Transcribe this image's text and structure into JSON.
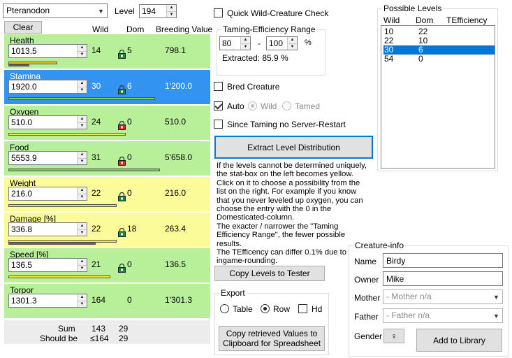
{
  "species": {
    "selected": "Pteranodon"
  },
  "level": {
    "label": "Level",
    "value": "194"
  },
  "clear_label": "Clear",
  "headers": {
    "wild": "Wild",
    "dom": "Dom",
    "breeding": "Breeding Value"
  },
  "stats": [
    {
      "name": "Health",
      "value": "1013.5",
      "wild": "14",
      "dom": "5",
      "breeding": "798.1",
      "bg": "#b8f09a",
      "lock": "unlocked"
    },
    {
      "name": "Stamina",
      "value": "1920.0",
      "wild": "30",
      "dom": "6",
      "breeding": "1'200.0",
      "bg": "#3294f0",
      "lock": "unlocked"
    },
    {
      "name": "Oxygen",
      "value": "510.0",
      "wild": "24",
      "dom": "0",
      "breeding": "510.0",
      "bg": "#b8f09a",
      "lock": "locked"
    },
    {
      "name": "Food",
      "value": "5553.9",
      "wild": "31",
      "dom": "0",
      "breeding": "5'658.0",
      "bg": "#b8f09a",
      "lock": "locked"
    },
    {
      "name": "Weight",
      "value": "216.0",
      "wild": "22",
      "dom": "0",
      "breeding": "216.0",
      "bg": "#fbfb9a",
      "lock": "unlocked"
    },
    {
      "name": "Damage [%]",
      "value": "336.8",
      "wild": "22",
      "dom": "18",
      "breeding": "263.4",
      "bg": "#fbfb9a",
      "lock": "unlocked"
    },
    {
      "name": "Speed [%]",
      "value": "136.5",
      "wild": "21",
      "dom": "0",
      "breeding": "136.5",
      "bg": "#b8f09a",
      "lock": "unlocked"
    },
    {
      "name": "Torpor",
      "value": "1301.3",
      "wild": "164",
      "dom": "0",
      "breeding": "1'301.3",
      "bg": "#b8f09a",
      "lock": "none"
    }
  ],
  "sum": {
    "label": "Sum",
    "wild": "143",
    "dom": "29"
  },
  "should_be": {
    "label": "Should be",
    "wild": "≤164",
    "dom": "29"
  },
  "quick_check": {
    "label": "Quick Wild-Creature Check",
    "checked": false
  },
  "te_range": {
    "title": "Taming-Efficiency Range",
    "min": "80",
    "separator": "-",
    "max": "100",
    "unit": "%",
    "extracted": "Extracted: 85.9 %"
  },
  "bred": {
    "label": "Bred Creature",
    "checked": false
  },
  "auto": {
    "label": "Auto",
    "checked": true
  },
  "wild_radio": {
    "label": "Wild",
    "checked": true
  },
  "tamed_radio": {
    "label": "Tamed",
    "checked": false
  },
  "since_taming": {
    "label": "Since Taming no Server-Restart",
    "checked": false
  },
  "extract_label": "Extract Level Distribution",
  "help_text": "If the levels cannot be determined uniquely, the stat-box on the left becomes yellow. Click on it to choose a possibility from the list on the right. For example if you know that you never leveled up oxygen, you can choose the entry with the 0 in the Domesticated-column.\nThe exacter / narrower the \"Taming Efficiency Range\", the fewer possible results.\nThe TEfficency can differ 0.1% due to ingame-rounding.",
  "copy_tester_label": "Copy Levels to Tester",
  "export": {
    "title": "Export",
    "table": "Table",
    "row": "Row",
    "hd": "Hd",
    "selected": "row",
    "hd_checked": false,
    "copy_label": "Copy retrieved Values to Clipboard for Spreadsheet"
  },
  "possible_levels": {
    "title": "Possible Levels",
    "headers": [
      "Wild",
      "Dom",
      "TEfficiency"
    ],
    "rows": [
      {
        "wild": "10",
        "dom": "22",
        "selected": false
      },
      {
        "wild": "22",
        "dom": "10",
        "selected": false
      },
      {
        "wild": "30",
        "dom": "6",
        "selected": true
      },
      {
        "wild": "54",
        "dom": "0",
        "selected": false
      }
    ]
  },
  "creature_info": {
    "title": "Creature-info",
    "name_label": "Name",
    "name": "Birdy",
    "owner_label": "Owner",
    "owner": "Mike",
    "mother_label": "Mother",
    "mother": "- Mother n/a",
    "father_label": "Father",
    "father": "- Father n/a",
    "gender_label": "Gender",
    "gender_symbol": "♀",
    "add_label": "Add to Library"
  },
  "colors": {
    "green": "#b8f09a",
    "yellow": "#fbfb9a",
    "selected": "#3294f0",
    "accent": "#0078d7"
  }
}
